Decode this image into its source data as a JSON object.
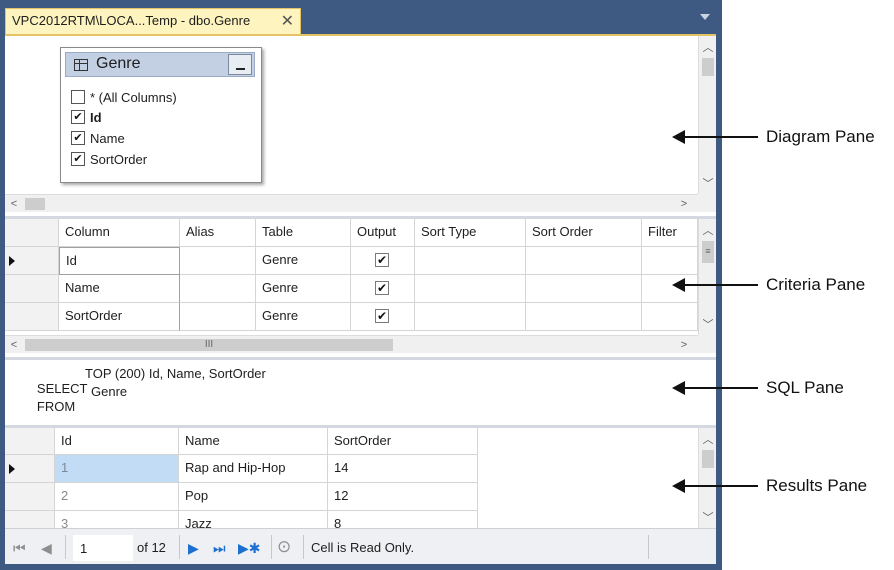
{
  "tab": {
    "title": "VPC2012RTM\\LOCA...Temp - dbo.Genre",
    "close": "✕"
  },
  "diagram": {
    "table_name": "Genre",
    "columns": [
      {
        "label": "* (All Columns)",
        "checked": false,
        "bold": false
      },
      {
        "label": "Id",
        "checked": true,
        "bold": true
      },
      {
        "label": "Name",
        "checked": true,
        "bold": false
      },
      {
        "label": "SortOrder",
        "checked": true,
        "bold": false
      }
    ]
  },
  "criteria": {
    "headers": [
      "Column",
      "Alias",
      "Table",
      "Output",
      "Sort Type",
      "Sort Order",
      "Filter"
    ],
    "rows": [
      {
        "column": "Id",
        "alias": "",
        "table": "Genre",
        "output": true
      },
      {
        "column": "Name",
        "alias": "",
        "table": "Genre",
        "output": true
      },
      {
        "column": "SortOrder",
        "alias": "",
        "table": "Genre",
        "output": true
      }
    ],
    "scroll_grip": "III"
  },
  "sql": {
    "line1_keyword": "SELECT",
    "line1_rest": "TOP (200) Id, Name, SortOrder",
    "line2_keyword": "FROM",
    "line2_rest": "Genre"
  },
  "results": {
    "headers": [
      "Id",
      "Name",
      "SortOrder"
    ],
    "rows": [
      {
        "id": "1",
        "name": "Rap and Hip-Hop",
        "sort": "14"
      },
      {
        "id": "2",
        "name": "Pop",
        "sort": "12"
      },
      {
        "id": "3",
        "name": "Jazz",
        "sort": "8"
      }
    ]
  },
  "status": {
    "page": "1",
    "of_pages": "of 12",
    "message": "Cell is Read Only."
  },
  "callouts": {
    "diagram": "Diagram Pane",
    "criteria": "Criteria Pane",
    "sql": "SQL Pane",
    "results": "Results Pane"
  },
  "colors": {
    "frame": "#3f5a82",
    "tab_active": "#fdf4bf",
    "selected_cell": "#c3dcf5"
  }
}
